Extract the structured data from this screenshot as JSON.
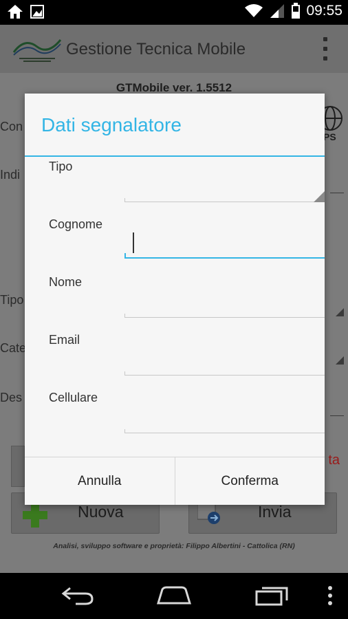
{
  "status_bar": {
    "time": "09:55",
    "icons": [
      "home-icon",
      "image-icon",
      "wifi-icon",
      "signal-icon",
      "battery-icon"
    ]
  },
  "app": {
    "title": "Gestione Tecnica Mobile",
    "version": "GTMobile ver. 1.5512",
    "background_labels": [
      "Con",
      "Indi",
      "Tipo",
      "Cate",
      "Des"
    ],
    "background_red_text": "ta",
    "gps_label": "PS",
    "buttons": {
      "nuova": "Nuova",
      "invia": "Invia"
    },
    "credits": "Analisi, sviluppo software e proprietà: Filippo Albertini - Cattolica (RN)"
  },
  "dialog": {
    "title": "Dati segnalatore",
    "fields": {
      "tipo": {
        "label": "Tipo",
        "value": ""
      },
      "cognome": {
        "label": "Cognome",
        "value": ""
      },
      "nome": {
        "label": "Nome",
        "value": ""
      },
      "email": {
        "label": "Email",
        "value": ""
      },
      "cellulare": {
        "label": "Cellulare",
        "value": ""
      }
    },
    "cancel_label": "Annulla",
    "confirm_label": "Conferma"
  },
  "colors": {
    "accent": "#33b5e5",
    "dim_background": "#7c7c7c",
    "dialog_background": "#f6f6f6"
  }
}
